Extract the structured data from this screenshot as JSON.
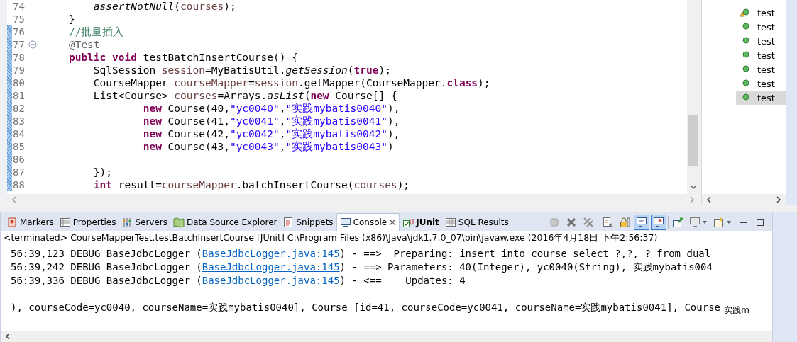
{
  "editor": {
    "lines": [
      {
        "number": "74",
        "changed": false,
        "foldable": false,
        "tokens": [
          {
            "kind": "static",
            "text": "        assertNotNull"
          },
          {
            "kind": "plain",
            "text": "("
          },
          {
            "kind": "var",
            "text": "courses"
          },
          {
            "kind": "plain",
            "text": ");"
          }
        ]
      },
      {
        "number": "75",
        "changed": false,
        "foldable": false,
        "tokens": [
          {
            "kind": "plain",
            "text": "    }"
          }
        ]
      },
      {
        "number": "76",
        "changed": true,
        "foldable": false,
        "tokens": [
          {
            "kind": "comment",
            "text": "    //批量插入"
          }
        ]
      },
      {
        "number": "77",
        "changed": true,
        "foldable": true,
        "tokens": [
          {
            "kind": "annotation",
            "text": "    @Test"
          }
        ]
      },
      {
        "number": "78",
        "changed": true,
        "foldable": false,
        "tokens": [
          {
            "kind": "keyword",
            "text": "    public"
          },
          {
            "kind": "keyword",
            "text": " void"
          },
          {
            "kind": "plain",
            "text": " testBatchInsertCourse() {"
          }
        ]
      },
      {
        "number": "79",
        "changed": true,
        "foldable": false,
        "tokens": [
          {
            "kind": "plain",
            "text": "        SqlSession "
          },
          {
            "kind": "var",
            "text": "session"
          },
          {
            "kind": "plain",
            "text": "=MyBatisUtil."
          },
          {
            "kind": "static",
            "text": "getSession"
          },
          {
            "kind": "plain",
            "text": "("
          },
          {
            "kind": "keyword",
            "text": "true"
          },
          {
            "kind": "plain",
            "text": ");"
          }
        ]
      },
      {
        "number": "80",
        "changed": true,
        "foldable": false,
        "tokens": [
          {
            "kind": "plain",
            "text": "        CourseMapper "
          },
          {
            "kind": "var",
            "text": "courseMapper"
          },
          {
            "kind": "plain",
            "text": "="
          },
          {
            "kind": "var",
            "text": "session"
          },
          {
            "kind": "plain",
            "text": ".getMapper(CourseMapper."
          },
          {
            "kind": "keyword",
            "text": "class"
          },
          {
            "kind": "plain",
            "text": ");"
          }
        ]
      },
      {
        "number": "81",
        "changed": true,
        "foldable": false,
        "tokens": [
          {
            "kind": "plain",
            "text": "        List<Course> "
          },
          {
            "kind": "var",
            "text": "courses"
          },
          {
            "kind": "plain",
            "text": "=Arrays."
          },
          {
            "kind": "static",
            "text": "asList"
          },
          {
            "kind": "plain",
            "text": "("
          },
          {
            "kind": "keyword",
            "text": "new"
          },
          {
            "kind": "plain",
            "text": " Course[] {"
          }
        ]
      },
      {
        "number": "82",
        "changed": true,
        "foldable": false,
        "tokens": [
          {
            "kind": "keyword",
            "text": "                new"
          },
          {
            "kind": "plain",
            "text": " Course(40,"
          },
          {
            "kind": "string",
            "text": "\"yc0040\""
          },
          {
            "kind": "plain",
            "text": ","
          },
          {
            "kind": "string",
            "text": "\"实践mybatis0040\""
          },
          {
            "kind": "plain",
            "text": "),"
          }
        ]
      },
      {
        "number": "83",
        "changed": true,
        "foldable": false,
        "tokens": [
          {
            "kind": "keyword",
            "text": "                new"
          },
          {
            "kind": "plain",
            "text": " Course(41,"
          },
          {
            "kind": "string",
            "text": "\"yc0041\""
          },
          {
            "kind": "plain",
            "text": ","
          },
          {
            "kind": "string",
            "text": "\"实践mybatis0041\""
          },
          {
            "kind": "plain",
            "text": "),"
          }
        ]
      },
      {
        "number": "84",
        "changed": true,
        "foldable": false,
        "tokens": [
          {
            "kind": "keyword",
            "text": "                new"
          },
          {
            "kind": "plain",
            "text": " Course(42,"
          },
          {
            "kind": "string",
            "text": "\"yc0042\""
          },
          {
            "kind": "plain",
            "text": ","
          },
          {
            "kind": "string",
            "text": "\"实践mybatis0042\""
          },
          {
            "kind": "plain",
            "text": "),"
          }
        ]
      },
      {
        "number": "85",
        "changed": true,
        "foldable": false,
        "tokens": [
          {
            "kind": "keyword",
            "text": "                new"
          },
          {
            "kind": "plain",
            "text": " Course(43,"
          },
          {
            "kind": "string",
            "text": "\"yc0043\""
          },
          {
            "kind": "plain",
            "text": ","
          },
          {
            "kind": "string",
            "text": "\"实践mybatis0043\""
          },
          {
            "kind": "plain",
            "text": ")"
          }
        ]
      },
      {
        "number": "86",
        "changed": true,
        "foldable": false
      },
      {
        "number": "87",
        "changed": true,
        "foldable": false,
        "tokens": [
          {
            "kind": "plain",
            "text": "        });"
          }
        ]
      },
      {
        "number": "88",
        "changed": true,
        "foldable": false,
        "tokens": [
          {
            "kind": "keyword",
            "text": "        int"
          },
          {
            "kind": "plain",
            "text": " result="
          },
          {
            "kind": "var",
            "text": "courseMapper"
          },
          {
            "kind": "plain",
            "text": ".batchInsertCourse("
          },
          {
            "kind": "var",
            "text": "courses"
          },
          {
            "kind": "plain",
            "text": ");"
          }
        ]
      }
    ]
  },
  "test_tree": {
    "items": [
      {
        "label": "test",
        "warning": true,
        "selected": false
      },
      {
        "label": "test",
        "warning": false,
        "selected": false
      },
      {
        "label": "test",
        "warning": false,
        "selected": false
      },
      {
        "label": "test",
        "warning": false,
        "selected": false
      },
      {
        "label": "test",
        "warning": false,
        "selected": false
      },
      {
        "label": "test",
        "warning": false,
        "selected": false
      },
      {
        "label": "test",
        "warning": false,
        "selected": true
      }
    ]
  },
  "bottom_panel": {
    "tabs": [
      {
        "label": "Markers",
        "kind": "markers",
        "selected": false,
        "closable": false
      },
      {
        "label": "Properties",
        "kind": "properties",
        "selected": false,
        "closable": false
      },
      {
        "label": "Servers",
        "kind": "servers",
        "selected": false,
        "closable": false
      },
      {
        "label": "Data Source Explorer",
        "kind": "datasource",
        "selected": false,
        "closable": false
      },
      {
        "label": "Snippets",
        "kind": "snippets",
        "selected": false,
        "closable": false
      },
      {
        "label": "Console",
        "kind": "console",
        "selected": true,
        "closable": true
      },
      {
        "label": "JUnit",
        "kind": "junit",
        "selected": false,
        "closable": false
      },
      {
        "label": "SQL Results",
        "kind": "sql",
        "selected": false,
        "closable": false
      }
    ],
    "toolbar_groups": [
      [
        {
          "kind": "stop",
          "pressed": false
        },
        {
          "kind": "remove",
          "pressed": false
        },
        {
          "kind": "remove_all",
          "pressed": false
        }
      ],
      [
        {
          "kind": "clear",
          "pressed": false
        },
        {
          "kind": "lock",
          "pressed": false
        },
        {
          "kind": "stdout",
          "pressed": true
        },
        {
          "kind": "stderr",
          "pressed": true
        }
      ],
      [
        {
          "kind": "pin",
          "pressed": false
        },
        {
          "kind": "display",
          "pressed": false
        },
        {
          "kind": "new_console",
          "pressed": false
        },
        {
          "kind": "minimize",
          "pressed": false
        },
        {
          "kind": "maximize",
          "pressed": false
        }
      ]
    ],
    "console": {
      "header": "<terminated> CourseMapperTest.testBatchInsertCourse [JUnit] C:\\Program Files (x86)\\Java\\jdk1.7.0_07\\bin\\javaw.exe (2016年4月18日 下午2:56:37)",
      "lines": [
        {
          "before": "56:39,123 DEBUG BaseJdbcLogger (",
          "link": "BaseJdbcLogger.java:145",
          "after": ") - ==>  Preparing: insert into course select ?,?, ? from dual"
        },
        {
          "before": "56:39,242 DEBUG BaseJdbcLogger (",
          "link": "BaseJdbcLogger.java:145",
          "after": ") - ==> Parameters: 40(Integer), yc0040(String), 实践mybatis004"
        },
        {
          "before": "56:39,336 DEBUG BaseJdbcLogger (",
          "link": "BaseJdbcLogger.java:145",
          "after": ") - <==    Updates: 4"
        }
      ],
      "result_line": "), courseCode=yc0040, courseName=实践mybatis0040], Course [id=41, courseCode=yc0041, courseName=实践mybatis0041], Course",
      "stray_text": "实践m"
    }
  }
}
